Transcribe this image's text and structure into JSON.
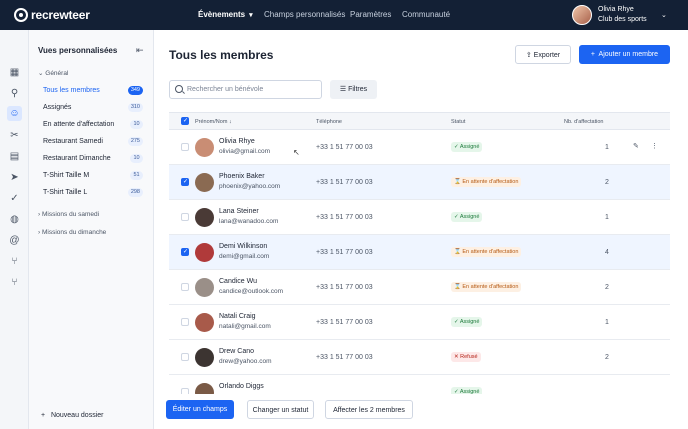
{
  "app": {
    "brand": "recrewteer"
  },
  "topnav": {
    "items": [
      {
        "label": "Évènements",
        "active": true,
        "chevron": "chevron-down-icon"
      },
      {
        "label": "Champs personnalisés"
      },
      {
        "label": "Paramètres"
      },
      {
        "label": "Communauté"
      }
    ]
  },
  "user": {
    "name": "Olivia Rhye",
    "org": "Club des sports"
  },
  "sidebar": {
    "title": "Vues personnalisées",
    "group_general": "Général",
    "views": [
      {
        "label": "Tous les membres",
        "count": "349",
        "active": true
      },
      {
        "label": "Assignés",
        "count": "310"
      },
      {
        "label": "En attente d'affectation",
        "count": "10"
      },
      {
        "label": "Restaurant Samedi",
        "count": "275"
      },
      {
        "label": "Restaurant Dimanche",
        "count": "10"
      },
      {
        "label": "T-Shirt Taille M",
        "count": "51"
      },
      {
        "label": "T-Shirt Taille L",
        "count": "298"
      }
    ],
    "groups": [
      "Missions du samedi",
      "Missions du dimanche"
    ],
    "new_folder": "Nouveau dossier"
  },
  "main": {
    "title": "Tous les membres",
    "export_label": "Exporter",
    "add_label": "Ajouter un membre",
    "search_placeholder": "Rechercher un bénévole",
    "filters_label": "Filtres"
  },
  "table": {
    "columns": {
      "name": "Prénom/Nom",
      "phone": "Téléphone",
      "status": "Statut",
      "assignments": "Nb. d'affectation"
    },
    "rows": [
      {
        "name": "Olivia Rhye",
        "email": "olivia@gmail.com",
        "phone": "+33 1 51 77 00 03",
        "status": "Assigné",
        "status_type": "green",
        "count": "1",
        "selected": false,
        "avatar_color": "#c98d74"
      },
      {
        "name": "Phoenix Baker",
        "email": "phoenix@yahoo.com",
        "phone": "+33 1 51 77 00 03",
        "status": "En attente d'affectation",
        "status_type": "orange",
        "count": "2",
        "selected": true,
        "avatar_color": "#8a6a52"
      },
      {
        "name": "Lana Steiner",
        "email": "lana@wanadoo.com",
        "phone": "+33 1 51 77 00 03",
        "status": "Assigné",
        "status_type": "green",
        "count": "1",
        "selected": false,
        "avatar_color": "#4a3a36"
      },
      {
        "name": "Demi Wilkinson",
        "email": "demi@gmail.com",
        "phone": "+33 1 51 77 00 03",
        "status": "En attente d'affectation",
        "status_type": "orange",
        "count": "4",
        "selected": true,
        "avatar_color": "#b03a3a"
      },
      {
        "name": "Candice Wu",
        "email": "candice@outlook.com",
        "phone": "+33 1 51 77 00 03",
        "status": "En attente d'affectation",
        "status_type": "orange",
        "count": "2",
        "selected": false,
        "avatar_color": "#9a8f88"
      },
      {
        "name": "Natali Craig",
        "email": "natali@gmail.com",
        "phone": "+33 1 51 77 00 03",
        "status": "Assigné",
        "status_type": "green",
        "count": "1",
        "selected": false,
        "avatar_color": "#a85a4a"
      },
      {
        "name": "Drew Cano",
        "email": "drew@yahoo.com",
        "phone": "+33 1 51 77 00 03",
        "status": "Refusé",
        "status_type": "red",
        "count": "2",
        "selected": false,
        "avatar_color": "#3c3431"
      },
      {
        "name": "Orlando Diggs",
        "email": "",
        "phone": "",
        "status": "Assigné",
        "status_type": "green",
        "count": "",
        "selected": false,
        "avatar_color": "#7a5a46"
      }
    ]
  },
  "bulk": {
    "edit_label": "Éditer un champs",
    "status_label": "Changer un statut",
    "assign_label": "Affecter les 2 membres"
  }
}
